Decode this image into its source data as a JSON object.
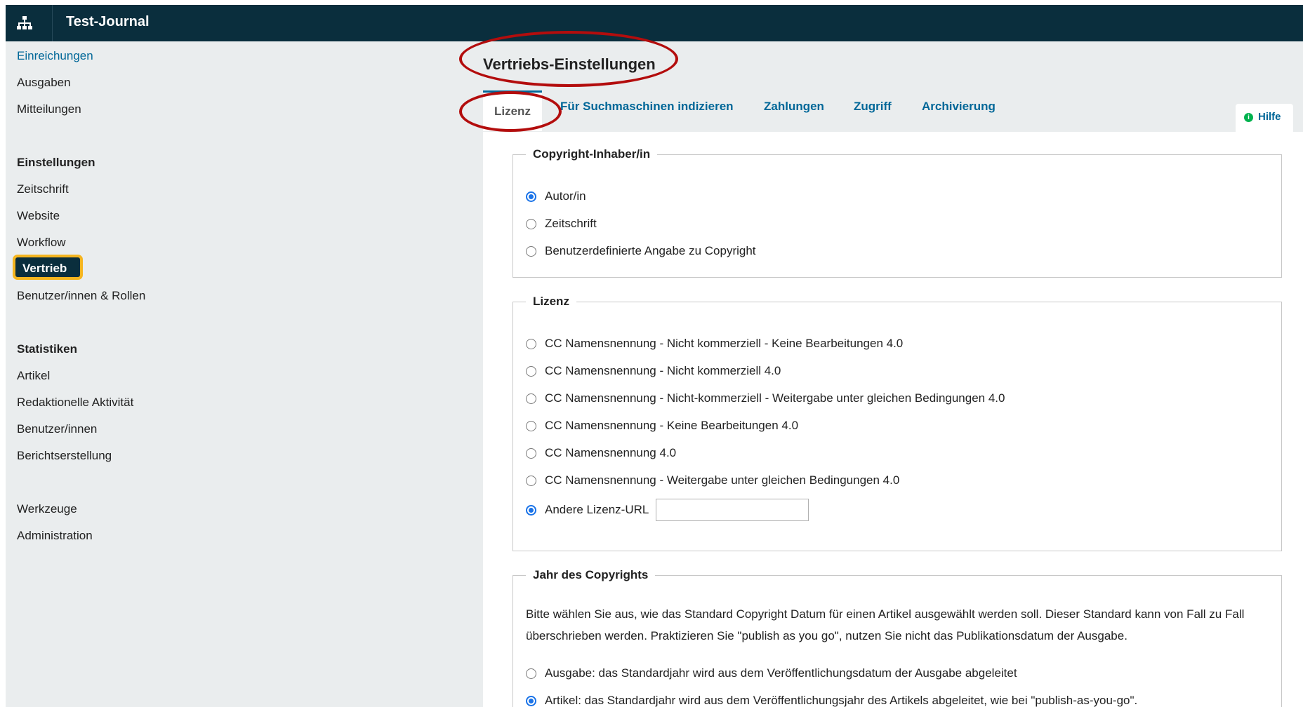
{
  "header": {
    "title": "Test-Journal",
    "icon": "sitemap-icon"
  },
  "sidebar": {
    "items": [
      {
        "label": "Einreichungen",
        "link": true
      },
      {
        "label": "Ausgaben"
      },
      {
        "label": "Mitteilungen"
      }
    ],
    "settings_heading": "Einstellungen",
    "settings_items": [
      "Zeitschrift",
      "Website",
      "Workflow",
      "Vertrieb",
      "Benutzer/innen & Rollen"
    ],
    "active_item": "Vertrieb",
    "stats_heading": "Statistiken",
    "stats_items": [
      "Artikel",
      "Redaktionelle Aktivität",
      "Benutzer/innen",
      "Berichtserstellung"
    ],
    "tools": "Werkzeuge",
    "admin": "Administration"
  },
  "main": {
    "title": "Vertriebs-Einstellungen",
    "tabs": [
      "Lizenz",
      "Für Suchmaschinen indizieren",
      "Zahlungen",
      "Zugriff",
      "Archivierung"
    ],
    "active_tab": "Lizenz",
    "help_label": "Hilfe",
    "help_icon_glyph": "i"
  },
  "copyright_holder": {
    "legend": "Copyright-Inhaber/in",
    "options": [
      "Autor/in",
      "Zeitschrift",
      "Benutzerdefinierte Angabe zu Copyright"
    ],
    "selected": "Autor/in"
  },
  "license": {
    "legend": "Lizenz",
    "options": [
      "CC Namensnennung - Nicht kommerziell - Keine Bearbeitungen 4.0",
      "CC Namensnennung - Nicht kommerziell 4.0",
      "CC Namensnennung - Nicht-kommerziell - Weitergabe unter gleichen Bedingungen 4.0",
      "CC Namensnennung - Keine Bearbeitungen 4.0",
      "CC Namensnennung 4.0",
      "CC Namensnennung - Weitergabe unter gleichen Bedingungen 4.0",
      "Andere Lizenz-URL"
    ],
    "selected": "Andere Lizenz-URL",
    "url_value": ""
  },
  "copyright_year": {
    "legend": "Jahr des Copyrights",
    "description": "Bitte wählen Sie aus, wie das Standard Copyright Datum für einen Artikel ausgewählt werden soll. Dieser Standard kann von Fall zu Fall überschrieben werden. Praktizieren Sie \"publish as you go\", nutzen Sie nicht das Publikationsdatum der Ausgabe.",
    "options": [
      "Ausgabe: das Standardjahr wird aus dem Veröffentlichungsdatum der Ausgabe abgeleitet",
      "Artikel: das Standardjahr wird aus dem Veröffentlichungsjahr des Artikels abgeleitet, wie bei \"publish-as-you-go\"."
    ],
    "selected": "Artikel: das Standardjahr wird aus dem Veröffentlichungsjahr des Artikels abgeleitet, wie bei \"publish-as-you-go\"."
  },
  "colors": {
    "topbar": "#0a2e3d",
    "link": "#006798",
    "highlight": "#f5b51f",
    "annotation": "#b30d0d",
    "radio_checked": "#1a73e8"
  }
}
